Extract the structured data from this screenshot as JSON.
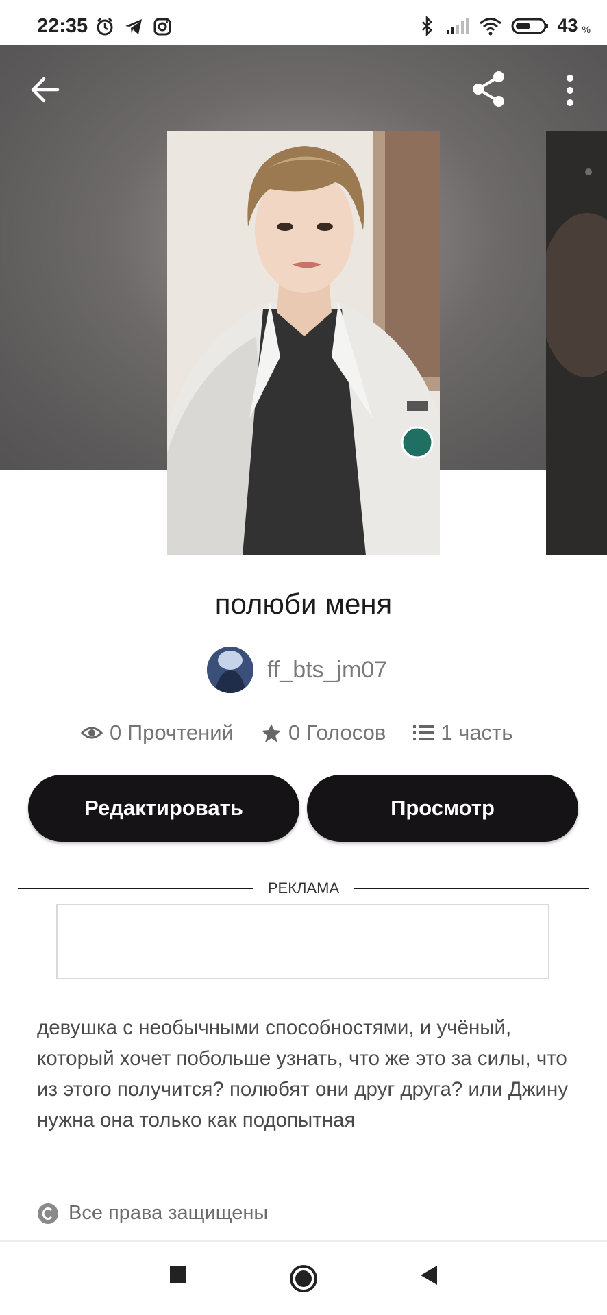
{
  "status_bar": {
    "time": "22:35",
    "battery": "43",
    "battery_unit": "%",
    "left_icons": [
      "alarm-icon",
      "telegram-icon",
      "instagram-icon"
    ],
    "right_icons": [
      "bluetooth-icon",
      "signal-icon",
      "wifi-icon",
      "battery-icon"
    ]
  },
  "toolbar": {
    "back_icon": "arrow-left-icon",
    "share_icon": "share-icon",
    "more_icon": "more-vert-icon"
  },
  "story": {
    "title": "полюби меня",
    "author": "ff_bts_jm07",
    "stats": {
      "reads": "0 Прочтений",
      "votes": "0 Голосов",
      "parts": "1 часть"
    },
    "description": "девушка с необычными способностями, и учёный, который хочет побольше узнать, что же это за силы, что из этого получится? полюбят они друг друга? или Джину нужна она только как подопытная",
    "rights": "Все права защищены"
  },
  "actions": {
    "edit_label": "Редактировать",
    "view_label": "Просмотр"
  },
  "ad": {
    "label": "РЕКЛАМА"
  },
  "nav": {
    "icons": [
      "recents-square-icon",
      "home-circle-icon",
      "back-triangle-icon"
    ]
  },
  "colors": {
    "button_bg": "#161316",
    "button_text": "#ffffff",
    "hero_bg": "#5b5959",
    "muted_text": "#757575"
  }
}
